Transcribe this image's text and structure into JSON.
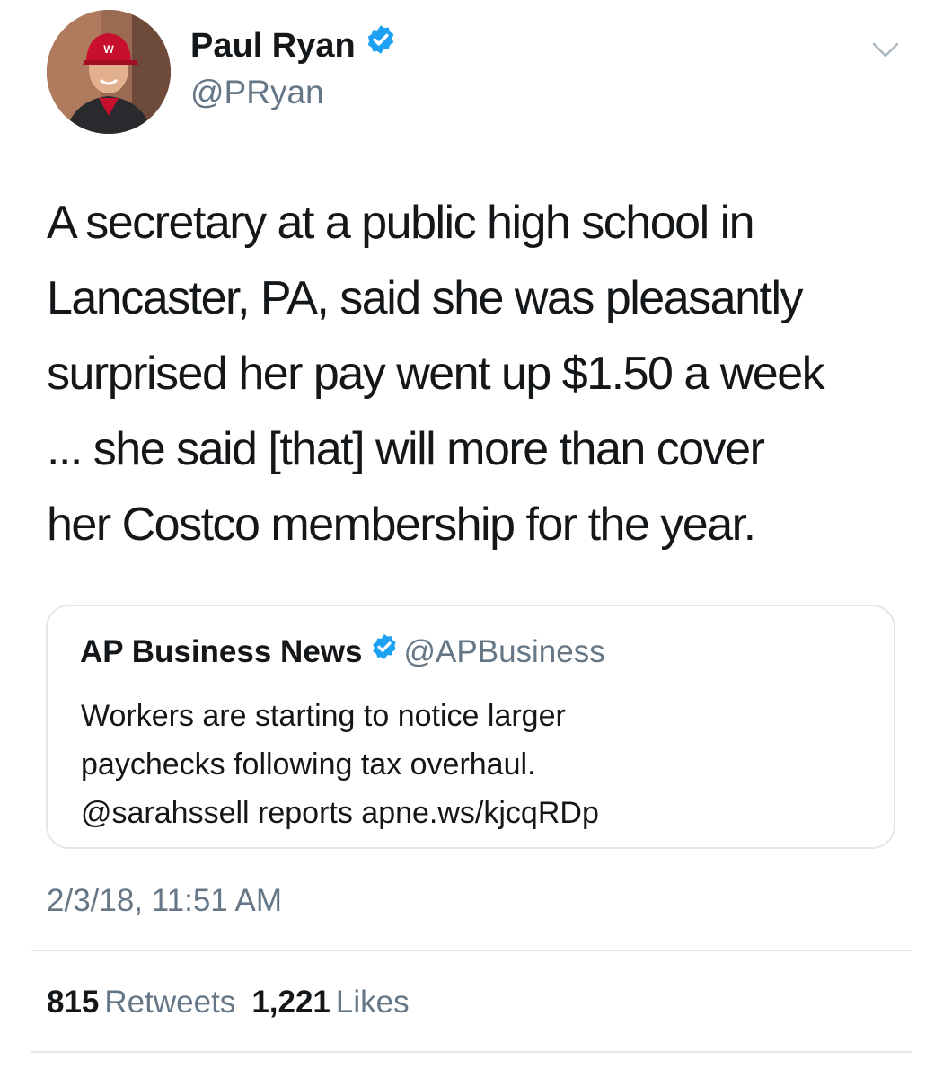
{
  "tweet": {
    "author": {
      "display_name": "Paul Ryan",
      "handle": "@PRyan",
      "verified": true,
      "avatar_icon": "profile-photo"
    },
    "text": "A secretary at a public high school in\nLancaster, PA, said she was pleasantly\nsurprised her pay went up $1.50 a week\n... she said [that] will more than cover\nher Costco membership for the year.",
    "quoted_tweet": {
      "display_name": "AP Business News",
      "handle": "@APBusiness",
      "verified": true,
      "text": "Workers are starting to notice larger\npaychecks following tax overhaul.\n@sarahssell reports apne.ws/kjcqRDp"
    },
    "timestamp": "2/3/18, 11:51 AM",
    "stats": {
      "retweets_count": "815",
      "retweets_label": "Retweets",
      "likes_count": "1,221",
      "likes_label": "Likes"
    }
  },
  "colors": {
    "text_primary": "#14171a",
    "text_secondary": "#657786",
    "verified_blue": "#1da1f2",
    "border": "#e1e8ed"
  },
  "icons": {
    "verified": "verified-badge-icon",
    "menu": "chevron-down-icon"
  }
}
